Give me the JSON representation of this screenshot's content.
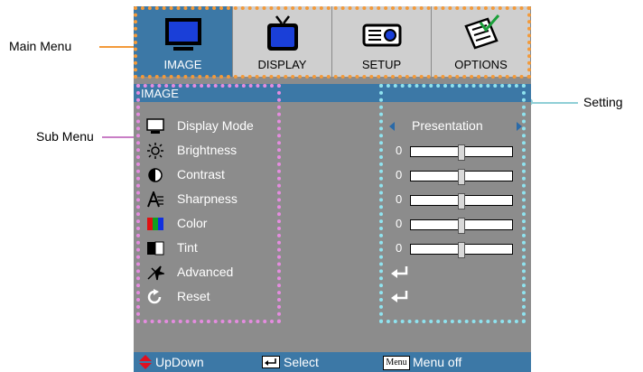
{
  "callouts": {
    "main_menu": "Main Menu",
    "sub_menu": "Sub Menu",
    "setting": "Setting"
  },
  "tabs": [
    {
      "label": "IMAGE",
      "icon": "monitor-icon",
      "active": true
    },
    {
      "label": "DISPLAY",
      "icon": "tv-icon",
      "active": false
    },
    {
      "label": "SETUP",
      "icon": "projector-icon",
      "active": false
    },
    {
      "label": "OPTIONS",
      "icon": "checklist-icon",
      "active": false
    }
  ],
  "panel": {
    "title": "IMAGE",
    "items": [
      {
        "label": "Display Mode",
        "icon": "display-mode-icon",
        "value": "Presentation"
      },
      {
        "label": "Brightness",
        "icon": "brightness-icon",
        "value": "0",
        "level": 0.5
      },
      {
        "label": "Contrast",
        "icon": "contrast-icon",
        "value": "0",
        "level": 0.5
      },
      {
        "label": "Sharpness",
        "icon": "sharpness-icon",
        "value": "0",
        "level": 0.5
      },
      {
        "label": "Color",
        "icon": "color-icon",
        "value": "0",
        "level": 0.5
      },
      {
        "label": "Tint",
        "icon": "tint-icon",
        "value": "0",
        "level": 0.5
      },
      {
        "label": "Advanced",
        "icon": "advanced-icon"
      },
      {
        "label": "Reset",
        "icon": "reset-icon"
      }
    ]
  },
  "status": {
    "updown": "UpDown",
    "select": "Select",
    "menu_key": "Menu",
    "menu_off": "Menu off"
  },
  "colors": {
    "accent": "#3c78a6",
    "panel": "#8c8c8c",
    "tab_inactive": "#cfcfcf",
    "main_menu_dots": "#f39a3a",
    "sub_menu_dots": "#e58ce0",
    "setting_dots": "#8fe3ef"
  }
}
